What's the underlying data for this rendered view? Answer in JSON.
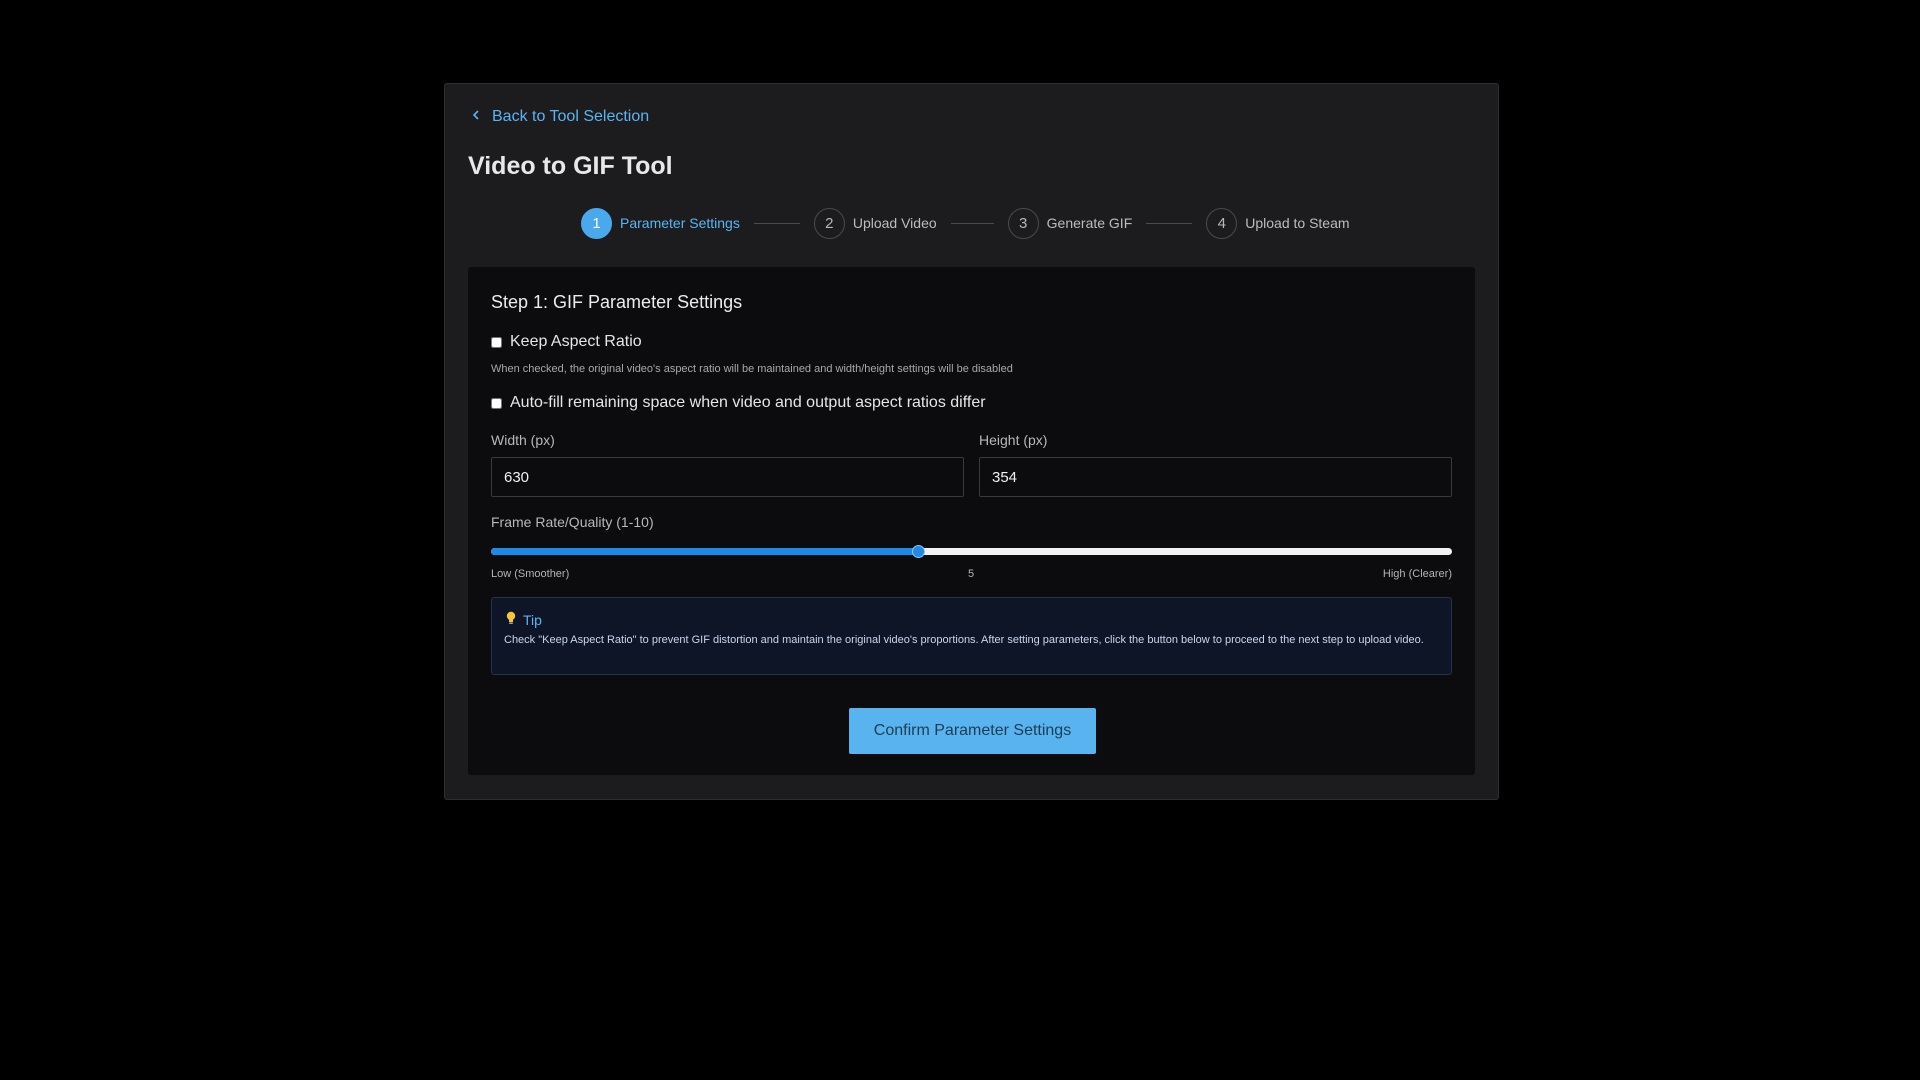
{
  "back_link": {
    "label": "Back to Tool Selection"
  },
  "page_title": "Video to GIF Tool",
  "steps": [
    {
      "number": "1",
      "label": "Parameter Settings",
      "active": true
    },
    {
      "number": "2",
      "label": "Upload Video",
      "active": false
    },
    {
      "number": "3",
      "label": "Generate GIF",
      "active": false
    },
    {
      "number": "4",
      "label": "Upload to Steam",
      "active": false
    }
  ],
  "form": {
    "section_title": "Step 1: GIF Parameter Settings",
    "keep_aspect": {
      "label": "Keep Aspect Ratio",
      "checked": false,
      "hint": "When checked, the original video's aspect ratio will be maintained and width/height settings will be disabled"
    },
    "auto_fill": {
      "label": "Auto-fill remaining space when video and output aspect ratios differ",
      "checked": false
    },
    "width": {
      "label": "Width (px)",
      "value": "630"
    },
    "height": {
      "label": "Height (px)",
      "value": "354"
    },
    "quality": {
      "label": "Frame Rate/Quality (1-10)",
      "min": 1,
      "max": 10,
      "value": 5,
      "value_label": "5",
      "low_label": "Low (Smoother)",
      "high_label": "High (Clearer)"
    },
    "tip": {
      "icon": "lightbulb-icon",
      "title": "Tip",
      "text": "Check \"Keep Aspect Ratio\" to prevent GIF distortion and maintain the original video's proportions. After setting parameters, click the button below to proceed to the next step to upload video."
    },
    "confirm_label": "Confirm Parameter Settings"
  },
  "colors": {
    "accent": "#4aa8ec",
    "slider_fill": "#1f8ae6",
    "button": "#58b3ef"
  }
}
